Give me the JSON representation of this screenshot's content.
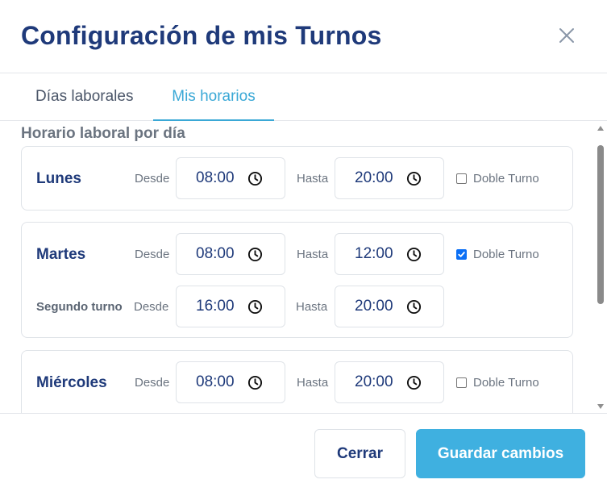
{
  "modal": {
    "title": "Configuración de mis Turnos",
    "close_icon": "close-icon"
  },
  "tabs": [
    {
      "label": "Días laborales",
      "active": false
    },
    {
      "label": "Mis horarios",
      "active": true
    }
  ],
  "section_title": "Horario laboral por día",
  "labels": {
    "from": "Desde",
    "to": "Hasta",
    "double_shift": "Doble Turno",
    "second_shift": "Segundo turno"
  },
  "days": [
    {
      "name": "Lunes",
      "from": "08:00",
      "to": "20:00",
      "double_shift": false
    },
    {
      "name": "Martes",
      "from": "08:00",
      "to": "12:00",
      "double_shift": true,
      "second_from": "16:00",
      "second_to": "20:00"
    },
    {
      "name": "Miércoles",
      "from": "08:00",
      "to": "20:00",
      "double_shift": false
    }
  ],
  "footer": {
    "close_label": "Cerrar",
    "save_label": "Guardar cambios"
  },
  "colors": {
    "primary_text": "#1f3a7a",
    "accent": "#3aa8d6",
    "save_button": "#3fb0e0",
    "checkbox_checked": "#0b6ff5"
  },
  "icons": {
    "time": "clock-icon",
    "checkbox": "check-icon"
  }
}
